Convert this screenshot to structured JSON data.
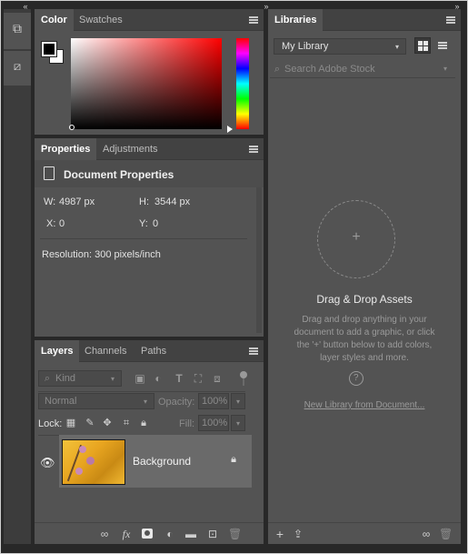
{
  "color_panel": {
    "tabs": [
      "Color",
      "Swatches"
    ]
  },
  "properties_panel": {
    "tabs": [
      "Properties",
      "Adjustments"
    ],
    "header": "Document Properties",
    "width_label": "W:",
    "width_value": "4987 px",
    "height_label": "H:",
    "height_value": "3544 px",
    "x_label": "X:",
    "x_value": "0",
    "y_label": "Y:",
    "y_value": "0",
    "resolution": "Resolution: 300 pixels/inch"
  },
  "layers_panel": {
    "tabs": [
      "Layers",
      "Channels",
      "Paths"
    ],
    "filter_kind": "Kind",
    "blend_mode": "Normal",
    "opacity_label": "Opacity:",
    "opacity_value": "100%",
    "lock_label": "Lock:",
    "fill_label": "Fill:",
    "fill_value": "100%",
    "layer_name": "Background"
  },
  "libraries_panel": {
    "tab": "Libraries",
    "library_select": "My Library",
    "search_placeholder": "Search Adobe Stock",
    "drop_title": "Drag & Drop Assets",
    "drop_text_1": "Drag and drop anything in your",
    "drop_text_2": "document to add a graphic, or click",
    "drop_text_3": "the '+' button below to add colors,",
    "drop_text_4": "layer styles and more.",
    "help_glyph": "?",
    "new_library_link": "New Library from Document..."
  },
  "colors": {
    "panel_bg": "#535353",
    "tabbar_bg": "#424242",
    "app_bg": "#282828"
  }
}
